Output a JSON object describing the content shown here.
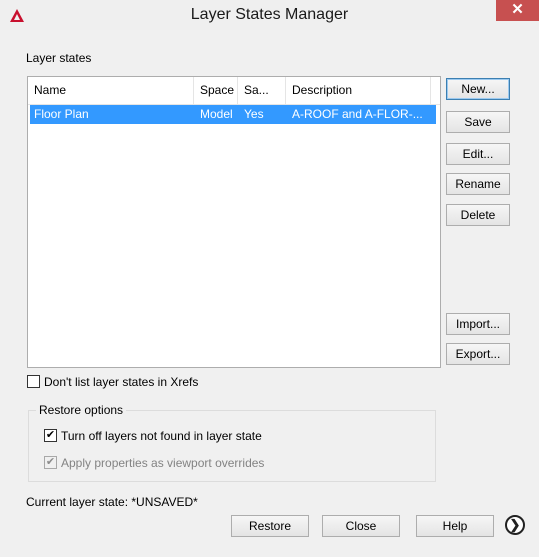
{
  "window": {
    "title": "Layer States Manager",
    "close_glyph": "✕",
    "app_icon": "autocad-logo-icon"
  },
  "layer_states": {
    "group_label": "Layer states",
    "columns": [
      "Name",
      "Space",
      "Sa...",
      "Description"
    ],
    "rows": [
      {
        "name": "Floor Plan",
        "space": "Model",
        "saved": "Yes",
        "description": "A-ROOF and A-FLOR-..."
      }
    ],
    "selected_row": 0
  },
  "side_buttons": {
    "new": "New...",
    "save": "Save",
    "edit": "Edit...",
    "rename": "Rename",
    "delete": "Delete",
    "import": "Import...",
    "export": "Export..."
  },
  "xrefs_checkbox": {
    "label": "Don't list layer states in Xrefs",
    "checked": false
  },
  "restore_options": {
    "legend": "Restore options",
    "turn_off": {
      "label": "Turn off layers not found in layer state",
      "checked": true
    },
    "apply_props": {
      "label": "Apply properties as viewport overrides",
      "checked": true,
      "enabled": false
    }
  },
  "status": {
    "current_layer_state": "Current layer state: *UNSAVED*"
  },
  "bottom_buttons": {
    "restore": "Restore",
    "close": "Close",
    "help": "Help",
    "more_glyph": "❯"
  },
  "colors": {
    "selection": "#3399ff",
    "close_button": "#c75050",
    "app_icon": "#c8102e"
  }
}
